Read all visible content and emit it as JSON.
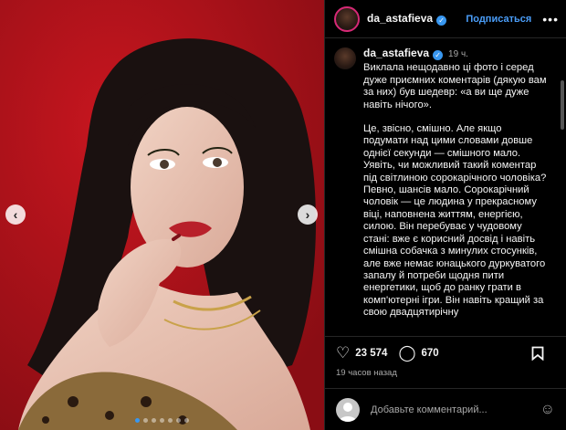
{
  "post": {
    "username": "da_astafieva",
    "follow_label": "Подписаться",
    "more_label": "•••",
    "time_ago": "19 ч.",
    "caption_paragraphs": [
      "Виклала нещодавно ці фото і серед дуже приємних коментарів (дякую вам за них) був шедевр: «а ви ще дуже навіть нічого».",
      "Це, звісно, смішно. Але якщо подумати над цими словами довше однієї секунди — смішного мало. Уявіть, чи можливий такий коментар під світлиною сорокарічного чоловіка? Певно, шансів мало. Сорокарічний чоловік — це людина у прекрасному віці, наповнена життям, енергією, силою. Він перебуває у чудовому стані: вже є корисний досвід і навіть смішна собачка з минулих стосунків, але вже немає юнацького дуркуватого запалу й потреби щодня пити енергетики, щоб до ранку грати в комп'ютерні ігри. Він навіть кращий за свою двадцятирічну"
    ],
    "likes": "23 574",
    "comments": "670",
    "posted_ago": "19 часов назад",
    "comment_placeholder": "Добавьте комментарий..."
  },
  "icons": {
    "prev": "chevron-left-icon",
    "next": "chevron-right-icon",
    "like": "heart-icon",
    "comment": "speech-bubble-icon",
    "bookmark": "bookmark-icon",
    "emoji": "emoji-icon",
    "verified": "verified-badge-icon"
  },
  "colors": {
    "accent": "#4a9df8",
    "photo_background": "#b0121a",
    "panel_background": "#000000"
  },
  "carousel": {
    "count": 7,
    "active_index": 0
  }
}
